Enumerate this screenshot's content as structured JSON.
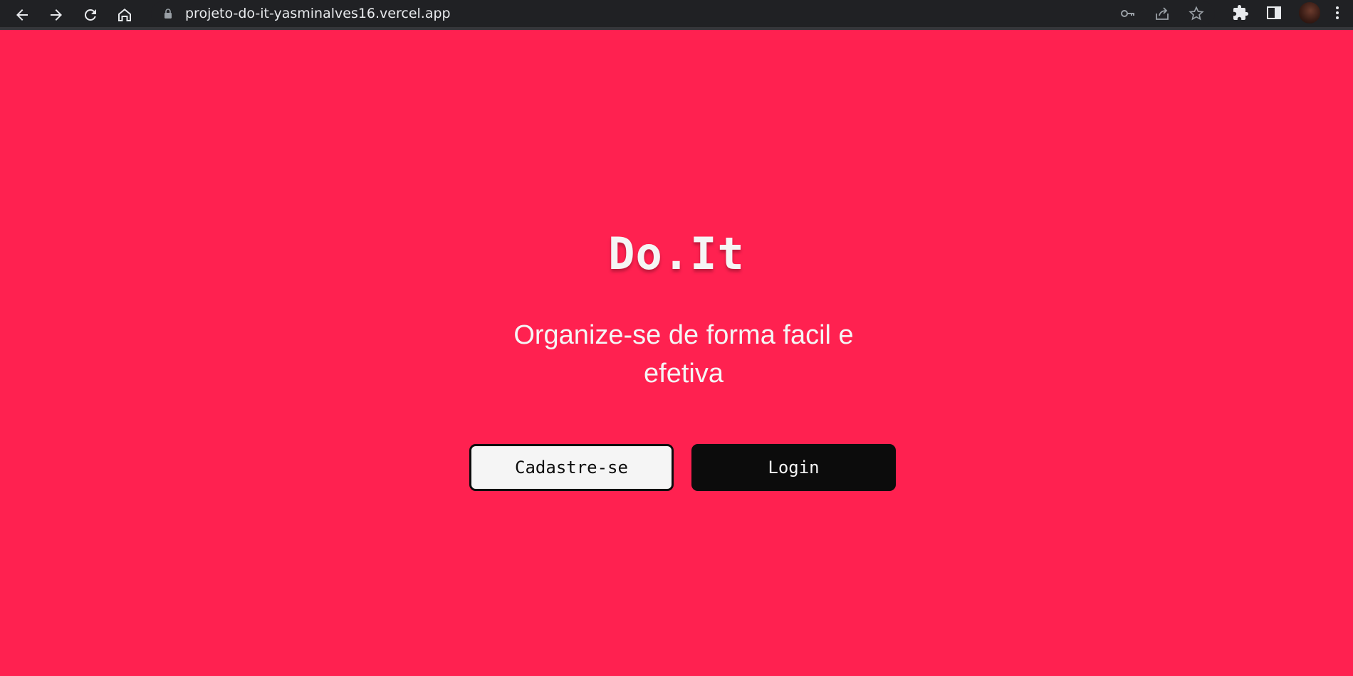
{
  "browser": {
    "url": "projeto-do-it-yasminalves16.vercel.app",
    "icons": {
      "back": "arrow-left-icon",
      "forward": "arrow-right-icon",
      "reload": "reload-icon",
      "home": "home-icon",
      "lock": "lock-icon",
      "key": "key-icon",
      "share": "share-icon",
      "bookmark": "star-icon",
      "extensions": "puzzle-icon",
      "side_panel": "side-panel-icon",
      "menu": "kebab-menu-icon"
    }
  },
  "hero": {
    "title": "Do.It",
    "tagline": "Organize-se de forma facil e efetiva",
    "signup_label": "Cadastre-se",
    "login_label": "Login"
  },
  "colors": {
    "background": "#ff2150",
    "text_light": "#f5f5f5",
    "button_dark": "#0c0c0c",
    "browser_chrome": "#202124"
  }
}
